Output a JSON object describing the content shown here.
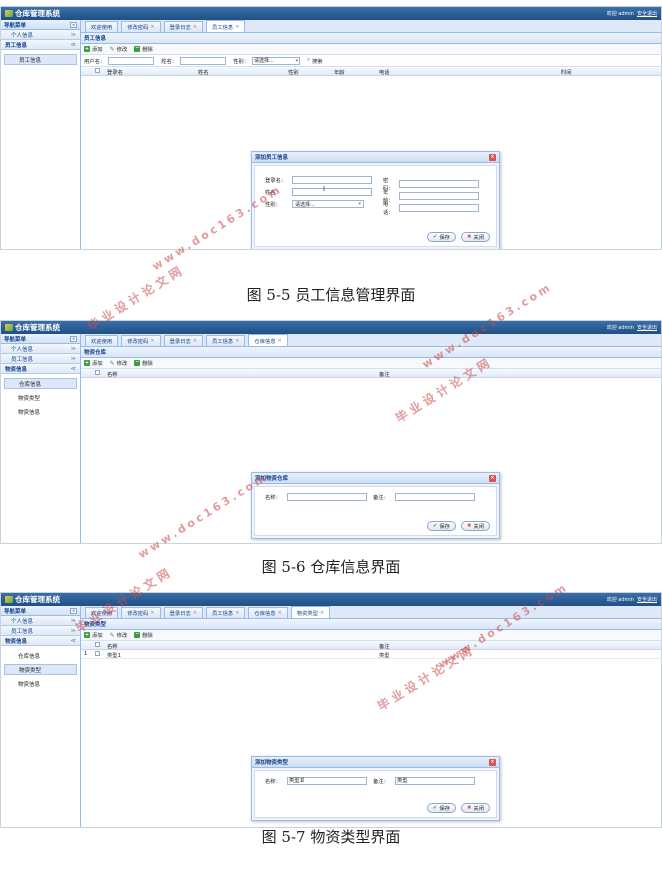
{
  "app": {
    "title": "仓库管理系统",
    "welcome": "欢迎 admin",
    "logout": "安全退出"
  },
  "sidebar": {
    "header": "导航菜单",
    "collapse": "«",
    "sections": [
      "个人信息",
      "员工信息",
      "物资信息"
    ],
    "items": {
      "employee": "员工信息",
      "warehouse": "仓库信息",
      "material_type": "物资类型",
      "material": "物资信息"
    }
  },
  "tabs": [
    "欢迎使用",
    "修改密码",
    "登录日志",
    "员工信息",
    "仓库信息",
    "物资类型"
  ],
  "close_glyph": "×",
  "toolbar": {
    "add": "添加",
    "edit": "修改",
    "delete": "删除"
  },
  "screen1": {
    "panel_title": "员工信息",
    "search": {
      "username_label": "用户名：",
      "name_label": "姓名：",
      "gender_label": "性别：",
      "gender_value": "请选择...",
      "search_label": "搜索"
    },
    "columns": [
      "登录名",
      "姓名",
      "性别",
      "年龄",
      "电话",
      "时间"
    ],
    "dialog": {
      "title": "添加员工信息",
      "login_label": "登录名：",
      "password_label": "密码：",
      "name_label": "姓名：",
      "age_label": "年龄：",
      "gender_label": "性别：",
      "gender_value": "请选择...",
      "phone_label": "电话："
    },
    "caption": "图 5-5 员工信息管理界面"
  },
  "screen2": {
    "panel_title": "物资仓库",
    "columns": [
      "名称",
      "备注"
    ],
    "dialog": {
      "title": "添加物资仓库",
      "name_label": "名称：",
      "note_label": "备注："
    },
    "caption": "图 5-6 仓库信息界面"
  },
  "screen3": {
    "panel_title": "物资类型",
    "columns": [
      "名称",
      "备注"
    ],
    "rows": [
      {
        "index": "1",
        "name": "类型1",
        "note": "类型"
      }
    ],
    "dialog": {
      "title": "添加物资类型",
      "name_label": "名称：",
      "name_value": "类型1",
      "note_label": "备注：",
      "note_value": "类型"
    },
    "caption": "图 5-7 物资类型界面"
  },
  "dialog_buttons": {
    "save": "保存",
    "close": "关闭"
  },
  "watermarks": {
    "text": "毕业设计论文网",
    "url": "www.doc163.com"
  },
  "icons": [
    "logo-icon",
    "add-icon",
    "edit-icon",
    "delete-icon",
    "search-icon",
    "close-icon",
    "save-check-icon",
    "cancel-x-icon",
    "chevron-icon",
    "text-cursor-icon"
  ]
}
